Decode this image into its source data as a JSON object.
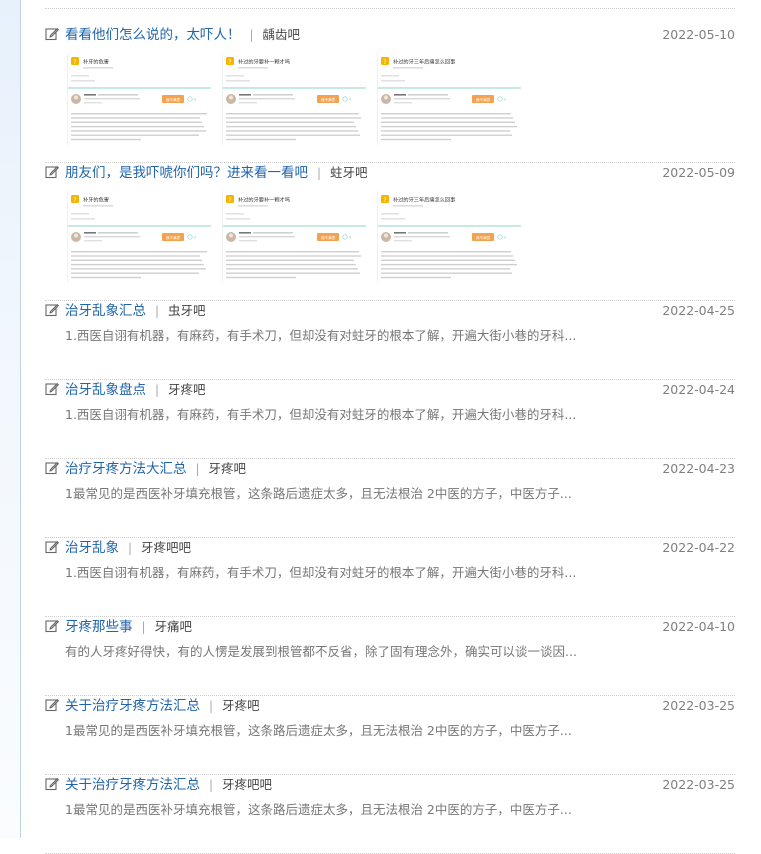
{
  "items": [
    {
      "title": "看看他们怎么说的，太吓人！",
      "forum": "龋齿吧",
      "date": "2022-05-10",
      "summary": "",
      "has_thumbs": true
    },
    {
      "title": "朋友们，是我吓唬你们吗？进来看一看吧",
      "forum": "蛀牙吧",
      "date": "2022-05-09",
      "summary": "",
      "has_thumbs": true
    },
    {
      "title": "治牙乱象汇总",
      "forum": "虫牙吧",
      "date": "2022-04-25",
      "summary": "1.西医自诩有机器，有麻药，有手术刀，但却没有对蛀牙的根本了解，开遍大街小巷的牙科...",
      "has_thumbs": false
    },
    {
      "title": "治牙乱象盘点",
      "forum": "牙疼吧",
      "date": "2022-04-24",
      "summary": "1.西医自诩有机器，有麻药，有手术刀，但却没有对蛀牙的根本了解，开遍大街小巷的牙科...",
      "has_thumbs": false
    },
    {
      "title": "治疗牙疼方法大汇总",
      "forum": "牙疼吧",
      "date": "2022-04-23",
      "summary": "1最常见的是西医补牙填充根管，这条路后遗症太多，且无法根治 2中医的方子，中医方子...",
      "has_thumbs": false
    },
    {
      "title": "治牙乱象",
      "forum": "牙疼吧吧",
      "date": "2022-04-22",
      "summary": "1.西医自诩有机器，有麻药，有手术刀，但却没有对蛀牙的根本了解，开遍大街小巷的牙科...",
      "has_thumbs": false
    },
    {
      "title": "牙疼那些事",
      "forum": "牙痛吧",
      "date": "2022-04-10",
      "summary": "有的人牙疼好得快，有的人愣是发展到根管都不反省，除了固有理念外，确实可以谈一谈因...",
      "has_thumbs": false
    },
    {
      "title": "关于治疗牙疼方法汇总",
      "forum": "牙疼吧",
      "date": "2022-03-25",
      "summary": "1最常见的是西医补牙填充根管，这条路后遗症太多，且无法根治 2中医的方子，中医方子...",
      "has_thumbs": false
    },
    {
      "title": "关于治疗牙疼方法汇总",
      "forum": "牙疼吧吧",
      "date": "2022-03-25",
      "summary": "1最常见的是西医补牙填充根管，这条路后遗症太多，且无法根治 2中医的方子，中医方子...",
      "has_thumbs": false
    }
  ],
  "thumbs": [
    {
      "heading": "补牙的危害",
      "button": "我不满意",
      "counter": "0"
    },
    {
      "heading": "补过的牙要补一颗才吗",
      "button": "我不满意",
      "counter": "0"
    },
    {
      "heading": "补过的牙三年后痛怎么回事",
      "button": "我不满意",
      "counter": "0"
    }
  ],
  "colors": {
    "link": "#1f64ad",
    "accent_orange": "#f3a24f",
    "badge_yellow": "#f5b400",
    "divider_teal": "#8fd3c8"
  },
  "icons": {
    "edit": "edit-icon",
    "question": "question-badge-icon",
    "avatar": "avatar-icon"
  }
}
